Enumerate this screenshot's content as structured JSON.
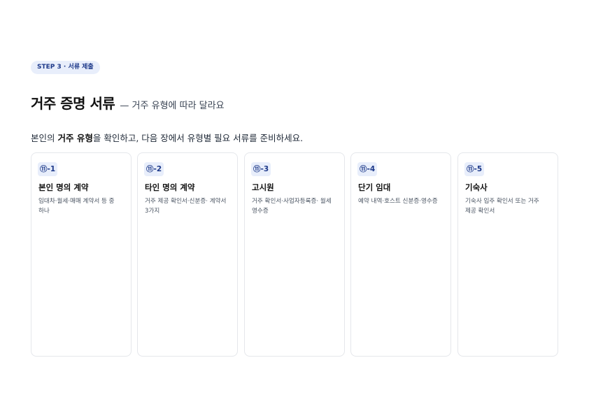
{
  "step_label": "STEP 3 · 서류 제출",
  "title": {
    "main": "거주 증명 서류",
    "sub": "— 거주 유형에 따라 달라요"
  },
  "intro": {
    "before": "본인의 ",
    "emphasis": "거주 유형",
    "after": "을 확인하고, 다음 장에서 유형별 필요 서류를 준비하세요."
  },
  "cards": [
    {
      "tag": "⑪-1",
      "title": "본인 명의 계약",
      "desc": "임대차·월세·매매 계약서 등 중 하나"
    },
    {
      "tag": "⑪-2",
      "title": "타인 명의 계약",
      "desc": "거주 제공 확인서·신분증· 계약서 3가지"
    },
    {
      "tag": "⑪-3",
      "title": "고시원",
      "desc": "거주 확인서·사업자등록증· 월세 영수증"
    },
    {
      "tag": "⑪-4",
      "title": "단기 임대",
      "desc": "예약 내역·호스트 신분증·영수증"
    },
    {
      "tag": "⑪-5",
      "title": "기숙사",
      "desc": "기숙사 입주 확인서 또는 거주 제공 확인서"
    }
  ],
  "colors": {
    "accent": "#1e3a8a",
    "badge_bg": "#e8eefb",
    "card_border": "#e5e7eb"
  }
}
